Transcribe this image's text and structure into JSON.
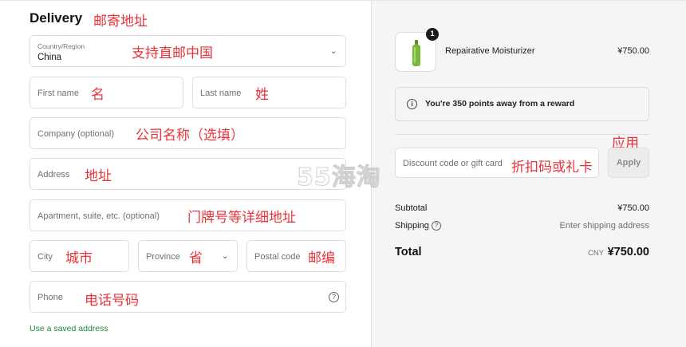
{
  "delivery": {
    "title": "Delivery",
    "country": {
      "label": "Country/Region",
      "value": "China"
    },
    "first_name": {
      "placeholder": "First name"
    },
    "last_name": {
      "placeholder": "Last name"
    },
    "company": {
      "placeholder": "Company (optional)"
    },
    "address": {
      "placeholder": "Address"
    },
    "apartment": {
      "placeholder": "Apartment, suite, etc. (optional)"
    },
    "city": {
      "placeholder": "City"
    },
    "province": {
      "placeholder": "Province"
    },
    "postal_code": {
      "placeholder": "Postal code"
    },
    "phone": {
      "placeholder": "Phone"
    },
    "saved_address_link": "Use a saved address"
  },
  "annotations": {
    "delivery": "邮寄地址",
    "country": "支持直邮中国",
    "first_name": "名",
    "last_name": "姓",
    "company": "公司名称（选填）",
    "address": "地址",
    "apartment": "门牌号等详细地址",
    "city": "城市",
    "province": "省",
    "postal_code": "邮编",
    "phone": "电话号码",
    "discount": "折扣码或礼卡",
    "apply": "应用"
  },
  "watermark": "55海淘",
  "summary": {
    "product": {
      "quantity": "1",
      "name": "Repairative Moisturizer",
      "price": "¥750.00"
    },
    "reward_text": "You're 350 points away from a reward",
    "discount": {
      "placeholder": "Discount code or gift card",
      "button": "Apply"
    },
    "subtotal": {
      "label": "Subtotal",
      "value": "¥750.00"
    },
    "shipping": {
      "label": "Shipping",
      "value": "Enter shipping address"
    },
    "total": {
      "label": "Total",
      "currency": "CNY",
      "value": "¥750.00"
    }
  },
  "colors": {
    "annotation": "#e8333a",
    "link": "#1f8a3a",
    "product_bottle": "#7ab83a"
  }
}
